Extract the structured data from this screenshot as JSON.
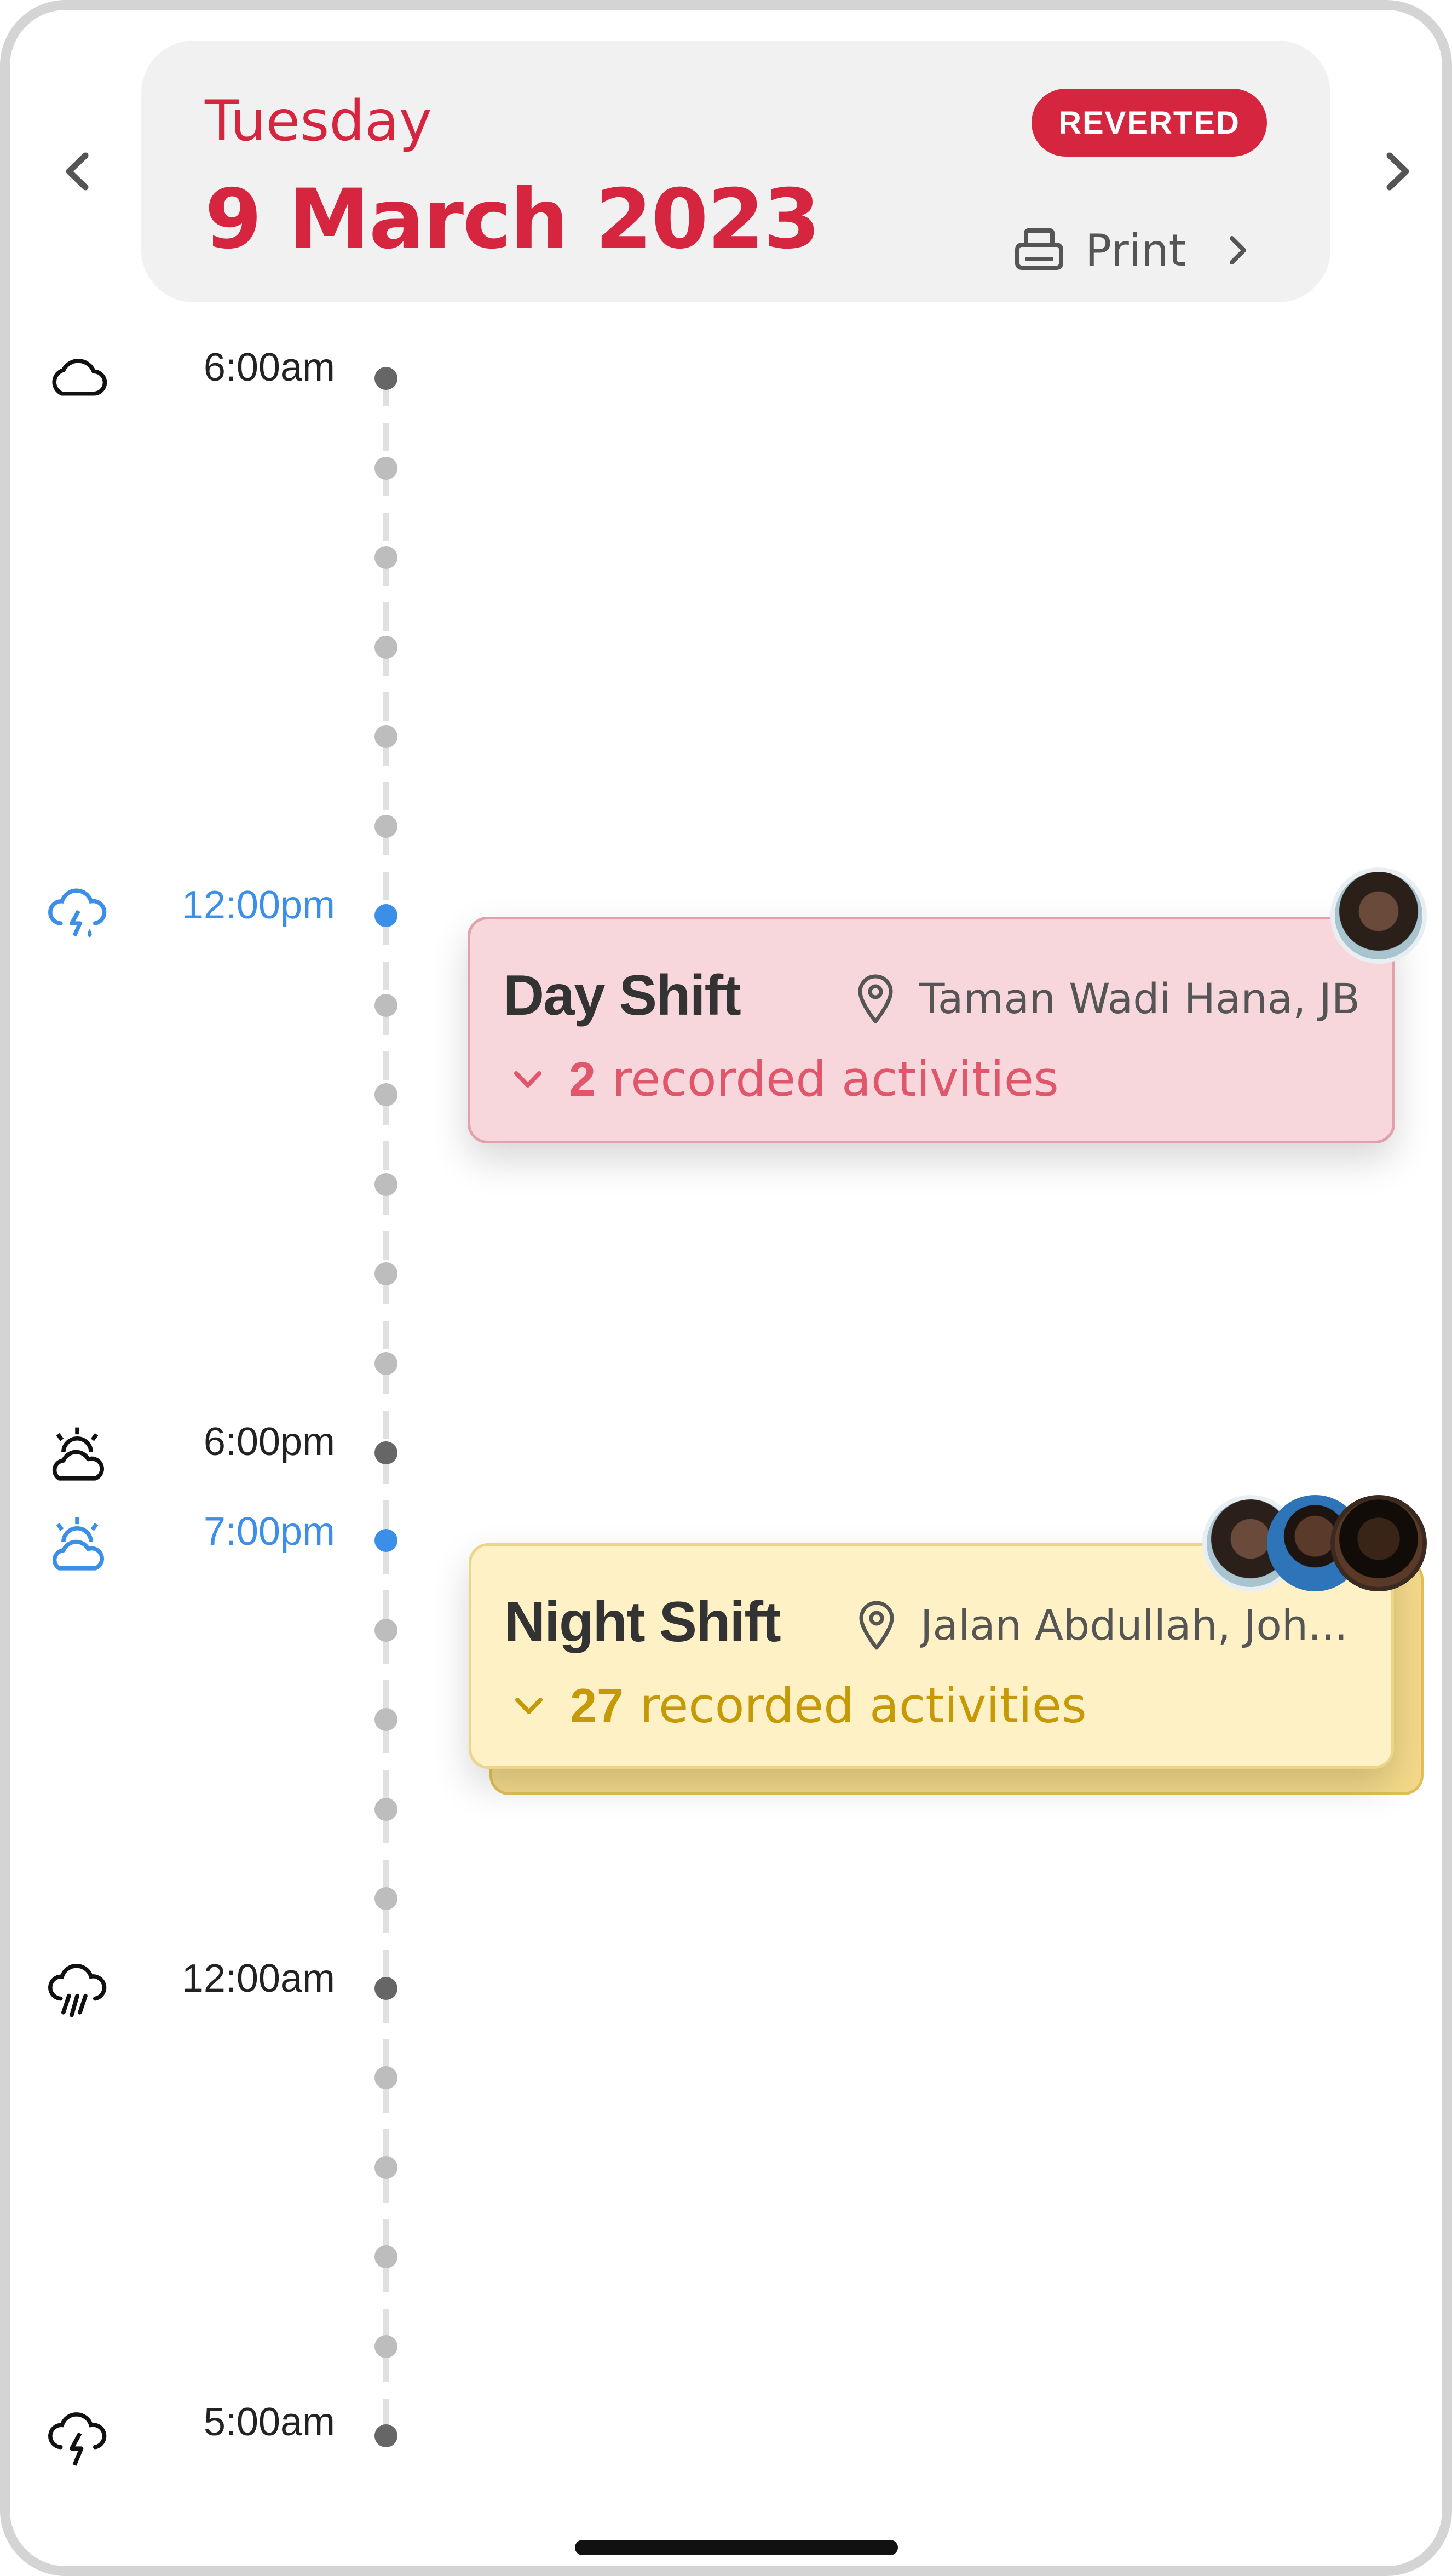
{
  "header": {
    "day_name": "Tuesday",
    "date": "9 March 2023",
    "status": "REVERTED",
    "print_label": "Print"
  },
  "timeline": {
    "labels": [
      {
        "time": "6:00am",
        "weather": "cloud-icon"
      },
      {
        "time": "12:00pm",
        "weather": "thunderstorm-rain-icon",
        "current": true
      },
      {
        "time": "6:00pm",
        "weather": "partly-cloudy-sun-icon"
      },
      {
        "time": "7:00pm",
        "weather": "partly-cloudy-sun-icon",
        "current": true
      },
      {
        "time": "12:00am",
        "weather": "heavy-rain-icon"
      },
      {
        "time": "5:00am",
        "weather": "thunder-icon"
      }
    ]
  },
  "shifts": [
    {
      "title": "Day Shift",
      "location": "Taman Wadi Hana, JB",
      "activity_count": "2",
      "activity_label": "recorded activities",
      "color": "#f7d6dc"
    },
    {
      "title": "Night Shift",
      "location": "Jalan Abdullah, Joh...",
      "activity_count": "27",
      "activity_label": "recorded activities",
      "color": "#fdf1c5"
    }
  ],
  "colors": {
    "accent": "#d6253f",
    "current_time": "#3b8fe8",
    "day_shift_text": "#e0566a",
    "night_shift_text": "#c59a06"
  }
}
